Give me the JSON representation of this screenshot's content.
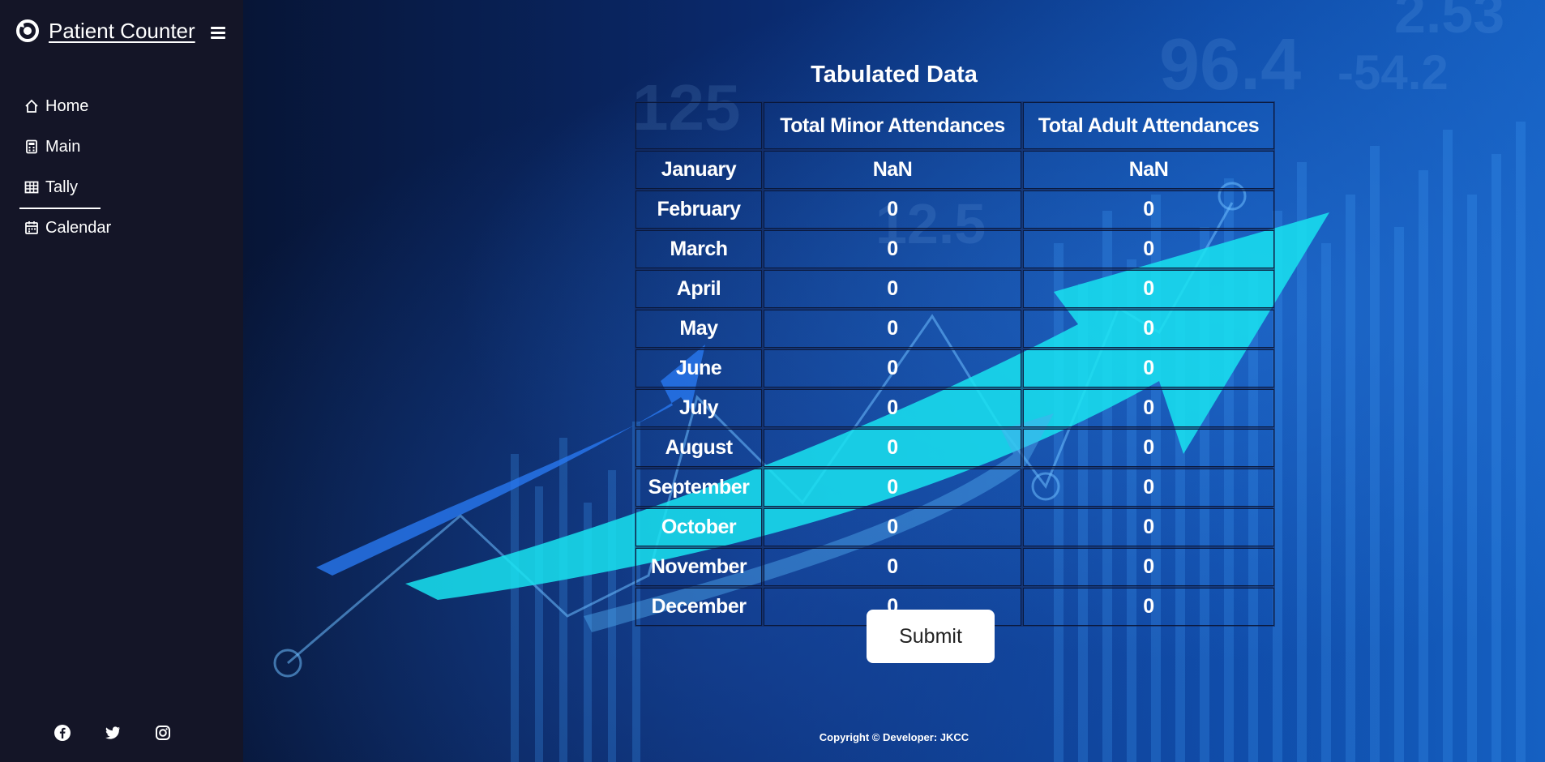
{
  "app": {
    "title": "Patient Counter"
  },
  "sidebar": {
    "items": [
      {
        "label": "Home",
        "icon": "home-icon"
      },
      {
        "label": "Main",
        "icon": "calculator-icon"
      },
      {
        "label": "Tally",
        "icon": "table-icon",
        "active": true
      },
      {
        "label": "Calendar",
        "icon": "calendar-icon"
      }
    ],
    "socials": [
      "facebook-icon",
      "twitter-icon",
      "instagram-icon"
    ]
  },
  "main": {
    "title": "Tabulated Data",
    "table": {
      "headers": [
        "",
        "Total Minor Attendances",
        "Total Adult Attendances"
      ],
      "rows": [
        [
          "January",
          "NaN",
          "NaN"
        ],
        [
          "February",
          "0",
          "0"
        ],
        [
          "March",
          "0",
          "0"
        ],
        [
          "April",
          "0",
          "0"
        ],
        [
          "May",
          "0",
          "0"
        ],
        [
          "June",
          "0",
          "0"
        ],
        [
          "July",
          "0",
          "0"
        ],
        [
          "August",
          "0",
          "0"
        ],
        [
          "September",
          "0",
          "0"
        ],
        [
          "October",
          "0",
          "0"
        ],
        [
          "November",
          "0",
          "0"
        ],
        [
          "December",
          "0",
          "0"
        ]
      ]
    },
    "submit_label": "Submit",
    "footer": "Copyright © Developer: JKCC"
  },
  "colors": {
    "sidebar_bg": "#141527",
    "accent_arrow": "#19e3f0"
  }
}
